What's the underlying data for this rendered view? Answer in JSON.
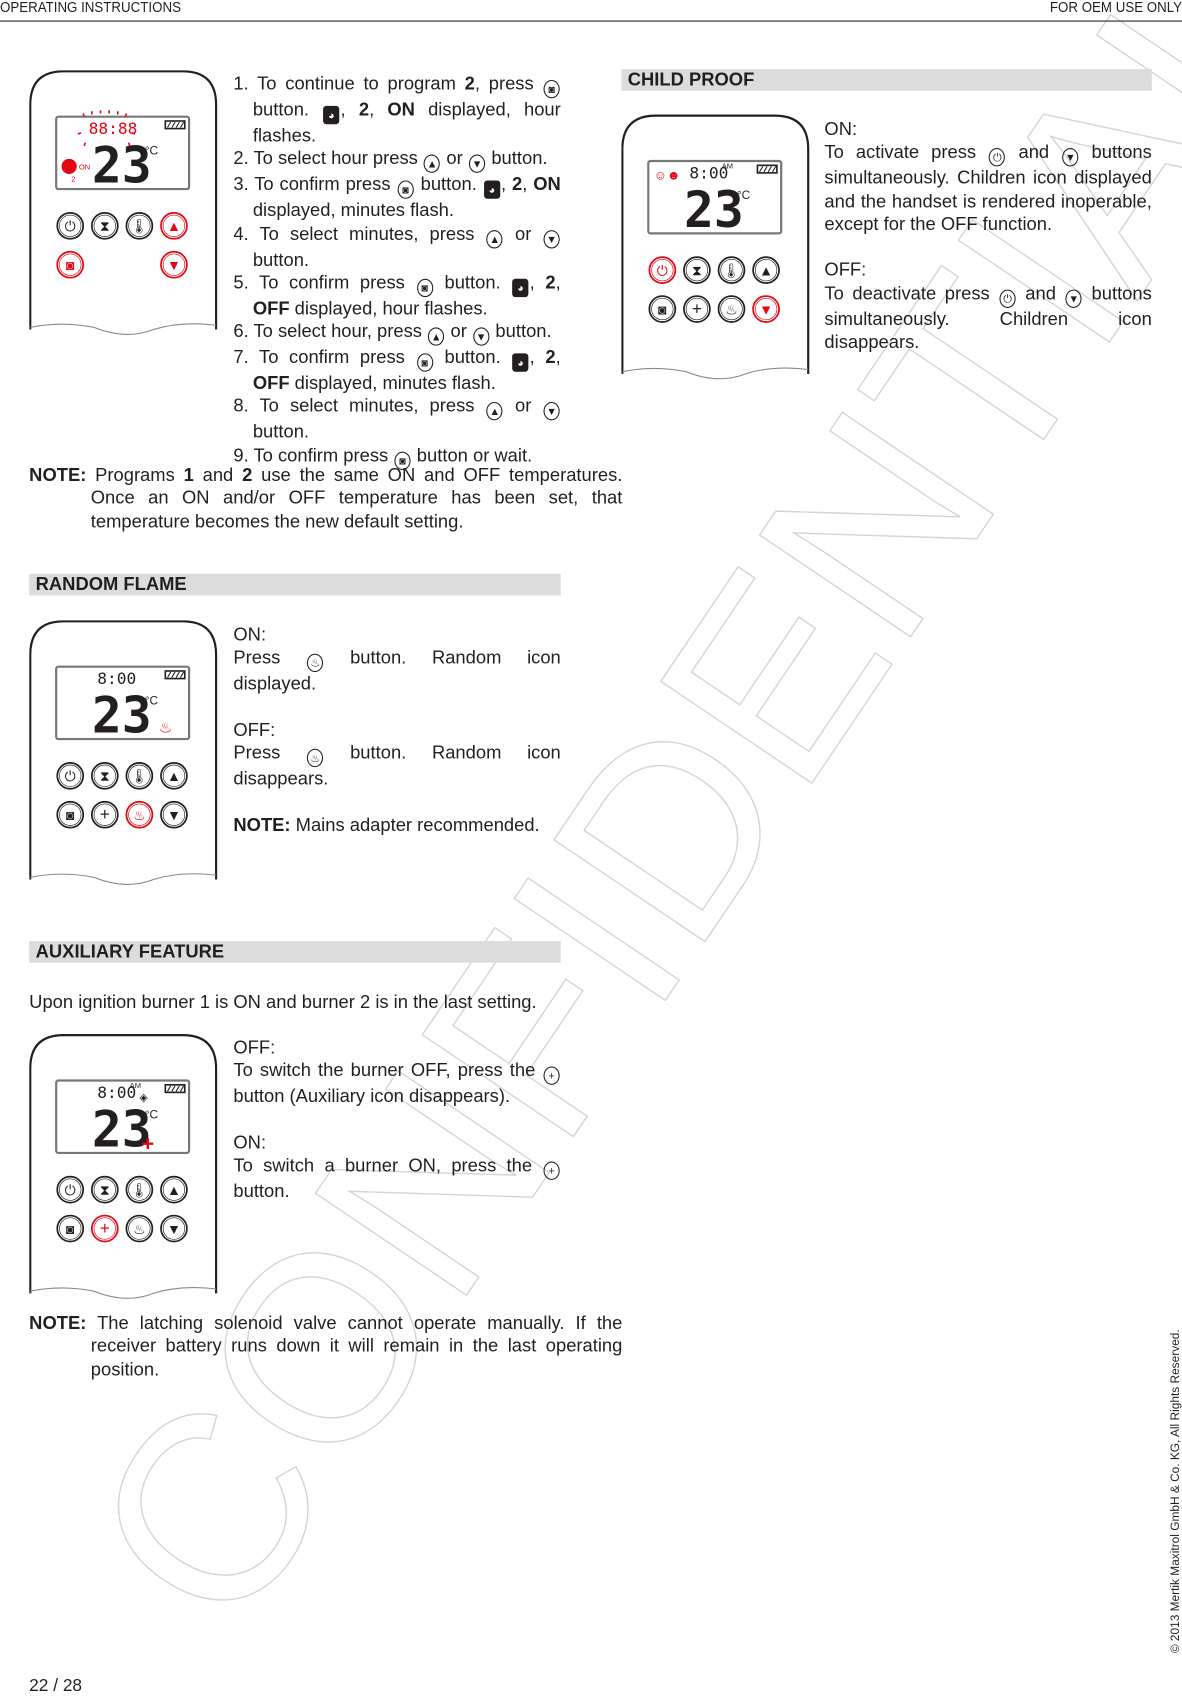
{
  "header": {
    "left": "OPERATING INSTRUCTIONS",
    "right": "FOR OEM USE ONLY"
  },
  "watermark": "CONFIDENTIAL",
  "colors": {
    "accent_red": "#e30613",
    "bar_bg": "#dcdcdc",
    "text": "#231f20"
  },
  "program": {
    "steps": [
      [
        {
          "t": "1. To continue to program "
        },
        {
          "b": "2"
        },
        {
          "t": ", press "
        },
        {
          "icon": "program-button-icon"
        },
        {
          "t": " button. "
        },
        {
          "icon": "program-display-icon"
        },
        {
          "t": ", "
        },
        {
          "b": "2"
        },
        {
          "t": ", "
        },
        {
          "b": "ON"
        },
        {
          "t": " displayed, hour flashes."
        }
      ],
      [
        {
          "t": "2. To select hour press "
        },
        {
          "icon": "up-button-icon"
        },
        {
          "t": " or "
        },
        {
          "icon": "down-button-icon"
        },
        {
          "t": " button."
        }
      ],
      [
        {
          "t": "3. To confirm press "
        },
        {
          "icon": "program-button-icon"
        },
        {
          "t": " button. "
        },
        {
          "icon": "program-display-icon"
        },
        {
          "t": ", "
        },
        {
          "b": "2"
        },
        {
          "t": ", "
        },
        {
          "b": "ON"
        },
        {
          "t": " displayed, minutes flash."
        }
      ],
      [
        {
          "t": "4. To select minutes, press "
        },
        {
          "icon": "up-button-icon"
        },
        {
          "t": " or "
        },
        {
          "icon": "down-button-icon"
        },
        {
          "t": " button."
        }
      ],
      [
        {
          "t": "5. To confirm press "
        },
        {
          "icon": "program-button-icon"
        },
        {
          "t": " button. "
        },
        {
          "icon": "program-display-icon"
        },
        {
          "t": ", "
        },
        {
          "b": "2"
        },
        {
          "t": ", "
        },
        {
          "b": "OFF"
        },
        {
          "t": " displayed, hour flashes."
        }
      ],
      [
        {
          "t": "6. To select hour, press "
        },
        {
          "icon": "up-button-icon"
        },
        {
          "t": " or "
        },
        {
          "icon": "down-button-icon"
        },
        {
          "t": " button."
        }
      ],
      [
        {
          "t": "7. To confirm press "
        },
        {
          "icon": "program-button-icon"
        },
        {
          "t": " button. "
        },
        {
          "icon": "program-display-icon"
        },
        {
          "t": ", "
        },
        {
          "b": "2"
        },
        {
          "t": ", "
        },
        {
          "b": "OFF"
        },
        {
          "t": " displayed, minutes flash."
        }
      ],
      [
        {
          "t": "8. To select minutes, press "
        },
        {
          "icon": "up-button-icon"
        },
        {
          "t": " or "
        },
        {
          "icon": "down-button-icon"
        },
        {
          "t": " button."
        }
      ],
      [
        {
          "t": "9. To confirm press "
        },
        {
          "icon": "program-button-icon"
        },
        {
          "t": " button or wait."
        }
      ]
    ],
    "note": [
      {
        "nb": "NOTE:"
      },
      {
        "t": " Programs "
      },
      {
        "b": "1"
      },
      {
        "t": " and "
      },
      {
        "b": "2"
      },
      {
        "t": " use the same ON and OFF temperatures. Once an ON and/or OFF temperature has been set, that temperature becomes the new default setting."
      }
    ]
  },
  "random_flame": {
    "title": "RANDOM FLAME",
    "paras": [
      [
        {
          "t": "ON:"
        }
      ],
      [
        {
          "t": "Press "
        },
        {
          "icon": "flame-button-icon"
        },
        {
          "t": " button. Random icon displayed."
        }
      ],
      [],
      [
        {
          "t": "OFF:"
        }
      ],
      [
        {
          "t": "Press "
        },
        {
          "icon": "flame-button-icon"
        },
        {
          "t": " button. Random icon disappears."
        }
      ],
      [],
      [
        {
          "nb": "NOTE:"
        },
        {
          "t": " Mains adapter recommended."
        }
      ]
    ]
  },
  "auxiliary": {
    "title": "AUXILIARY FEATURE",
    "intro": "Upon ignition burner 1 is ON and burner 2 is in the last setting.",
    "paras": [
      [
        {
          "t": "OFF:"
        }
      ],
      [
        {
          "t": "To switch the burner OFF, press the "
        },
        {
          "icon": "auxiliary-button-icon"
        },
        {
          "t": " button (Auxiliary icon disappears)."
        }
      ],
      [],
      [
        {
          "t": "ON:"
        }
      ],
      [
        {
          "t": "To switch a burner ON, press the "
        },
        {
          "icon": "auxiliary-button-icon"
        },
        {
          "t": " button."
        }
      ]
    ],
    "note": [
      {
        "nb": "NOTE:"
      },
      {
        "t": " The latching solenoid valve cannot operate manually. If the receiver battery runs down it will remain in the last operating position."
      }
    ]
  },
  "child_proof": {
    "title": "CHILD PROOF",
    "paras": [
      [
        {
          "t": "ON:"
        }
      ],
      [
        {
          "t": "To activate press "
        },
        {
          "icon": "power-button-icon"
        },
        {
          "t": " and "
        },
        {
          "icon": "down-button-icon"
        },
        {
          "t": " buttons simultaneously. Children icon displayed and the handset is rendered inoperable, except for the OFF function."
        }
      ],
      [],
      [
        {
          "t": "OFF:"
        }
      ],
      [
        {
          "t": "To deactivate press "
        },
        {
          "icon": "power-button-icon"
        },
        {
          "t": " and "
        },
        {
          "icon": "down-button-icon"
        },
        {
          "t": " buttons simultaneously. Children icon disappears."
        }
      ]
    ]
  },
  "remotes": [
    {
      "time": "88:88",
      "ampm": "",
      "temp": "23",
      "unit": "°C",
      "time_red": true,
      "side": "program-on",
      "side_label": "ON",
      "side_num": "2",
      "red": [
        "up",
        "program",
        "down"
      ],
      "row2": [
        "program",
        "",
        "",
        "down"
      ]
    },
    {
      "time": "8:00",
      "ampm": "",
      "temp": "23",
      "unit": "°C",
      "time_red": false,
      "side": "flame",
      "red": [
        "flame"
      ],
      "row2": [
        "program",
        "aux",
        "flame",
        "down"
      ]
    },
    {
      "time": "8:00",
      "ampm": "AM",
      "temp": "23",
      "unit": "°C",
      "time_red": false,
      "side": "aux",
      "red": [
        "aux"
      ],
      "row2": [
        "program",
        "aux",
        "flame",
        "down"
      ]
    },
    {
      "time": "8:00",
      "ampm": "AM",
      "temp": "23",
      "unit": "°C",
      "time_red": false,
      "side": "child",
      "red": [
        "power",
        "down"
      ],
      "row2": [
        "program",
        "aux",
        "flame",
        "down"
      ]
    }
  ],
  "footer": {
    "copyright": "© 2013 Mertik Maxitrol GmbH & Co. KG, All Rights Reserved.",
    "page": "22 / 28"
  }
}
